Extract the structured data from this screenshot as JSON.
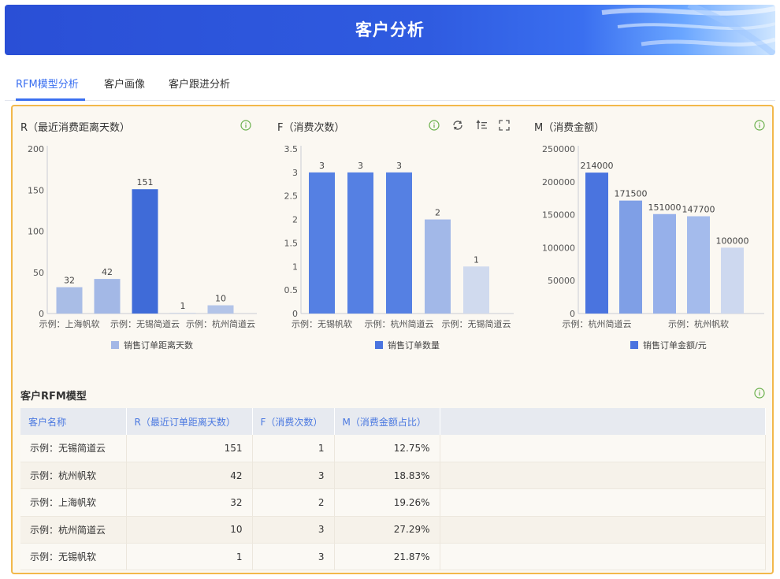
{
  "header": {
    "title": "客户分析"
  },
  "tabs": [
    {
      "label": "RFM模型分析",
      "active": true
    },
    {
      "label": "客户画像",
      "active": false
    },
    {
      "label": "客户跟进分析",
      "active": false
    }
  ],
  "colors": {
    "accent": "#3a6ff0",
    "frame_border": "#f2b84b",
    "header_text": "#4a78e0"
  },
  "toolbar_icons": [
    "refresh-icon",
    "sort-icon",
    "fullscreen-icon"
  ],
  "chart_data": [
    {
      "type": "bar",
      "title": "R（最近消费距离天数）",
      "categories": [
        "示例：上海帆软",
        "示例：杭州帆软",
        "示例：无锡简道云",
        "示例：无锡帆软",
        "示例：杭州简道云"
      ],
      "x_tick_labels": [
        "示例：上海帆软",
        "示例：无锡简道云",
        "示例：杭州简道云"
      ],
      "series": [
        {
          "name": "销售订单距离天数",
          "values": [
            32,
            42,
            151,
            1,
            10
          ]
        }
      ],
      "ylim": [
        0,
        200
      ],
      "yticks": [
        0,
        50,
        100,
        150,
        200
      ],
      "legend": "bottom",
      "bar_colors": [
        "#a9bde6",
        "#a3b8e6",
        "#3f6bd8",
        "#d3dae9",
        "#b3c4e8"
      ]
    },
    {
      "type": "bar",
      "title": "F（消费次数）",
      "categories": [
        "示例：无锡帆软",
        "示例：杭州帆软",
        "示例：杭州简道云",
        "示例：上海帆软",
        "示例：无锡简道云"
      ],
      "x_tick_labels": [
        "示例：无锡帆软",
        "示例：杭州简道云",
        "示例：无锡简道云"
      ],
      "series": [
        {
          "name": "销售订单数量",
          "values": [
            3,
            3,
            3,
            2,
            1
          ]
        }
      ],
      "ylim": [
        0,
        3.5
      ],
      "yticks": [
        "0",
        "0.5",
        "1",
        "1.5",
        "2",
        "2.5",
        "3",
        "3.5"
      ],
      "legend": "bottom",
      "bar_colors": [
        "#5580e3",
        "#5580e3",
        "#5580e3",
        "#a2b8e8",
        "#d0daee"
      ]
    },
    {
      "type": "bar",
      "title": "M（消费金额）",
      "categories": [
        "示例：杭州简道云",
        "示例：上海帆软",
        "示例：无锡帆软",
        "示例：杭州帆软",
        "示例：无锡简道云"
      ],
      "x_tick_labels": [
        "示例：杭州简道云",
        "示例：杭州帆软"
      ],
      "series": [
        {
          "name": "销售订单金额/元",
          "values": [
            214000,
            171500,
            151000,
            147700,
            100000
          ]
        }
      ],
      "ylim": [
        0,
        250000
      ],
      "yticks": [
        0,
        50000,
        100000,
        150000,
        200000,
        250000
      ],
      "legend": "bottom",
      "bar_colors": [
        "#4a74df",
        "#7f9fe6",
        "#96b0ea",
        "#a4bbec",
        "#cdd8ef"
      ]
    },
    {
      "type": "table",
      "title": "客户RFM模型",
      "columns": [
        "客户名称",
        "R（最近订单距离天数）",
        "F（消费次数）",
        "M（消费金额占比）"
      ],
      "rows": [
        [
          "示例：无锡简道云",
          "151",
          "1",
          "12.75%"
        ],
        [
          "示例：杭州帆软",
          "42",
          "3",
          "18.83%"
        ],
        [
          "示例：上海帆软",
          "32",
          "2",
          "19.26%"
        ],
        [
          "示例：杭州简道云",
          "10",
          "3",
          "27.29%"
        ],
        [
          "示例：无锡帆软",
          "1",
          "3",
          "21.87%"
        ]
      ]
    }
  ]
}
